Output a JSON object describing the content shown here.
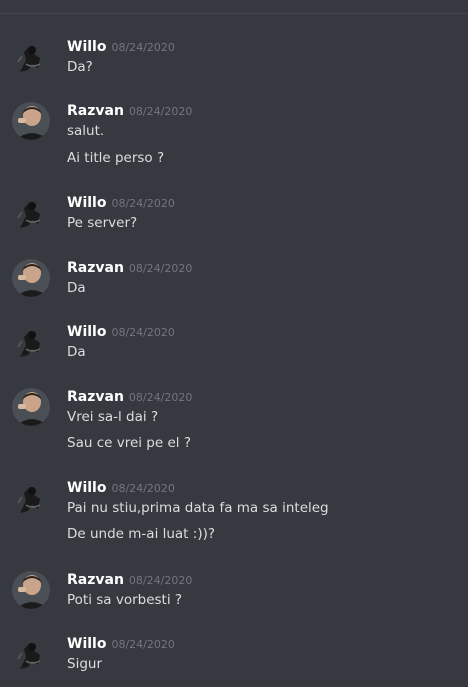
{
  "messages": [
    {
      "author": "Willo",
      "timestamp": "08/24/2020",
      "avatar": "willo-avatar",
      "lines": [
        "Da?"
      ]
    },
    {
      "author": "Razvan",
      "timestamp": "08/24/2020",
      "avatar": "razvan-avatar",
      "lines": [
        "salut.",
        "Ai title perso ?"
      ]
    },
    {
      "author": "Willo",
      "timestamp": "08/24/2020",
      "avatar": "willo-avatar",
      "lines": [
        "Pe server?"
      ]
    },
    {
      "author": "Razvan",
      "timestamp": "08/24/2020",
      "avatar": "razvan-avatar",
      "lines": [
        "Da"
      ]
    },
    {
      "author": "Willo",
      "timestamp": "08/24/2020",
      "avatar": "willo-avatar",
      "lines": [
        "Da"
      ]
    },
    {
      "author": "Razvan",
      "timestamp": "08/24/2020",
      "avatar": "razvan-avatar",
      "lines": [
        "Vrei sa-l dai ?",
        "Sau ce vrei pe el ?"
      ]
    },
    {
      "author": "Willo",
      "timestamp": "08/24/2020",
      "avatar": "willo-avatar",
      "lines": [
        "Pai nu stiu,prima data fa ma sa inteleg",
        "De unde m-ai luat :))?"
      ]
    },
    {
      "author": "Razvan",
      "timestamp": "08/24/2020",
      "avatar": "razvan-avatar",
      "lines": [
        "Poti sa vorbesti ?"
      ]
    },
    {
      "author": "Willo",
      "timestamp": "08/24/2020",
      "avatar": "willo-avatar",
      "lines": [
        "Sigur"
      ]
    }
  ]
}
